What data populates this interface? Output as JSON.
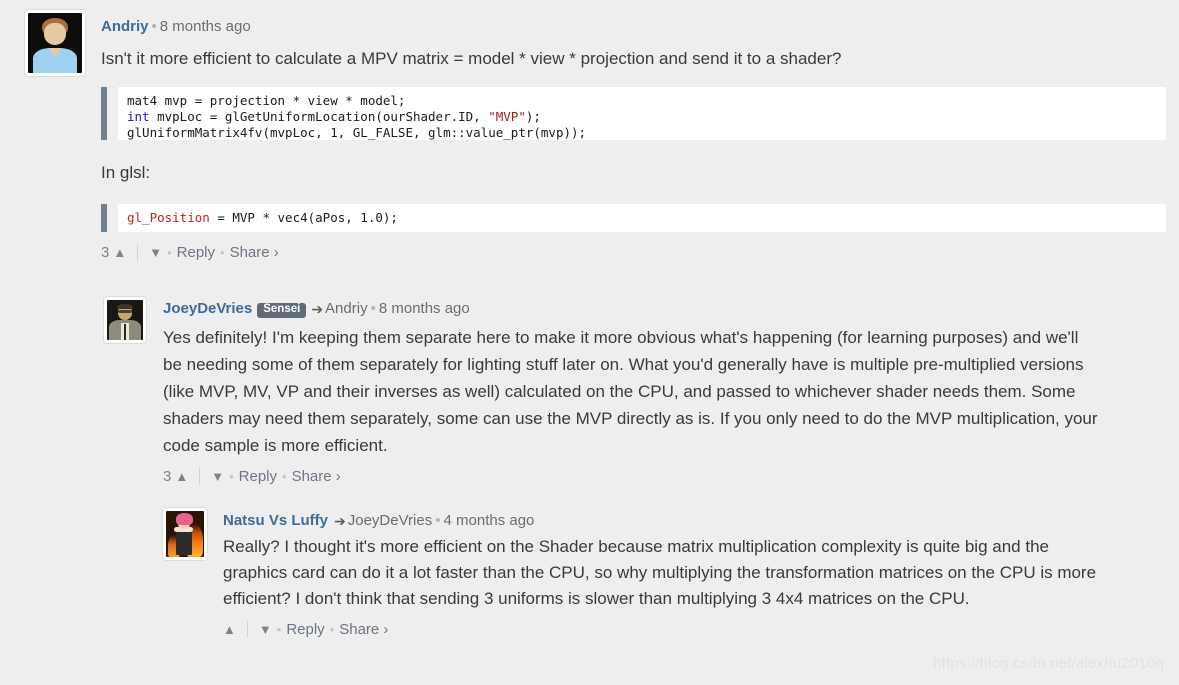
{
  "page": {
    "background_color": "#eeeeee",
    "watermark": "https://blog.csdn.net/alexhu2010q"
  },
  "comments": [
    {
      "id": "comment-andriy",
      "author": "Andriy",
      "badge": null,
      "reply_arrow": null,
      "parent_author": null,
      "timestamp": "8 months ago",
      "separator": "•",
      "avatar": "avatar-andriy",
      "text": "Isn't it more efficient to calculate a MPV matrix = model * view * projection and send it to a shader?",
      "code_blocks": [
        {
          "id": "code-cpp",
          "lines": [
            "mat4 mvp = projection * view * model;",
            "int mvpLoc = glGetUniformLocation(ourShader.ID, \"MVP\");",
            "glUniformMatrix4fv(mvpLoc, 1, GL_FALSE, glm::value_ptr(mvp));"
          ]
        }
      ],
      "mid_text": "In glsl:",
      "code_blocks_2": [
        {
          "id": "code-glsl",
          "lines": [
            "gl_Position = MVP * vec4(aPos, 1.0);"
          ]
        }
      ],
      "actions": {
        "vote_count": "3",
        "upvote_icon": "chevron-up-icon",
        "downvote_icon": "chevron-down-icon",
        "reply_label": "Reply",
        "share_label": "Share ›",
        "dot": "•"
      }
    },
    {
      "id": "comment-joeydevries",
      "author": "JoeyDeVries",
      "badge": "Sensei",
      "reply_arrow": "➔",
      "parent_author": "Andriy",
      "timestamp": "8 months ago",
      "separator": "•",
      "avatar": "avatar-joeydevries",
      "text": "Yes definitely! I'm keeping them separate here to make it more obvious what's happening (for learning purposes) and we'll be needing some of them separately for lighting stuff later on. What you'd generally have is multiple pre-multiplied versions (like MVP, MV, VP and their inverses as well) calculated on the CPU, and passed to whichever shader needs them. Some shaders may need them separately, some can use the MVP directly as is. If you only need to do the MVP multiplication, your code sample is more efficient.",
      "actions": {
        "vote_count": "3",
        "upvote_icon": "chevron-up-icon",
        "downvote_icon": "chevron-down-icon",
        "reply_label": "Reply",
        "share_label": "Share ›",
        "dot": "•"
      }
    },
    {
      "id": "comment-natsu",
      "author": "Natsu Vs Luffy",
      "badge": null,
      "reply_arrow": "➔",
      "parent_author": "JoeyDeVries",
      "timestamp": "4 months ago",
      "separator": "•",
      "avatar": "avatar-natsu",
      "text": "Really? I thought it's more efficient on the Shader because matrix multiplication complexity is quite big and the graphics card can do it a lot faster than the CPU, so why multiplying the transformation matrices on the CPU is more efficient? I don't think that sending 3 uniforms is slower than multiplying 3 4x4 matrices on the CPU.",
      "actions": {
        "vote_count": "",
        "upvote_icon": "chevron-up-icon",
        "downvote_icon": "chevron-down-icon",
        "reply_label": "Reply",
        "share_label": "Share ›",
        "dot": "•"
      }
    }
  ],
  "colors": {
    "author_link": "#3c6c9b",
    "badge_bg": "#5d6b7a",
    "code_bar": "#72808d",
    "code_keyword": "#1414c8",
    "code_string": "#9b1b1b",
    "code_identifier": "#c22222"
  }
}
